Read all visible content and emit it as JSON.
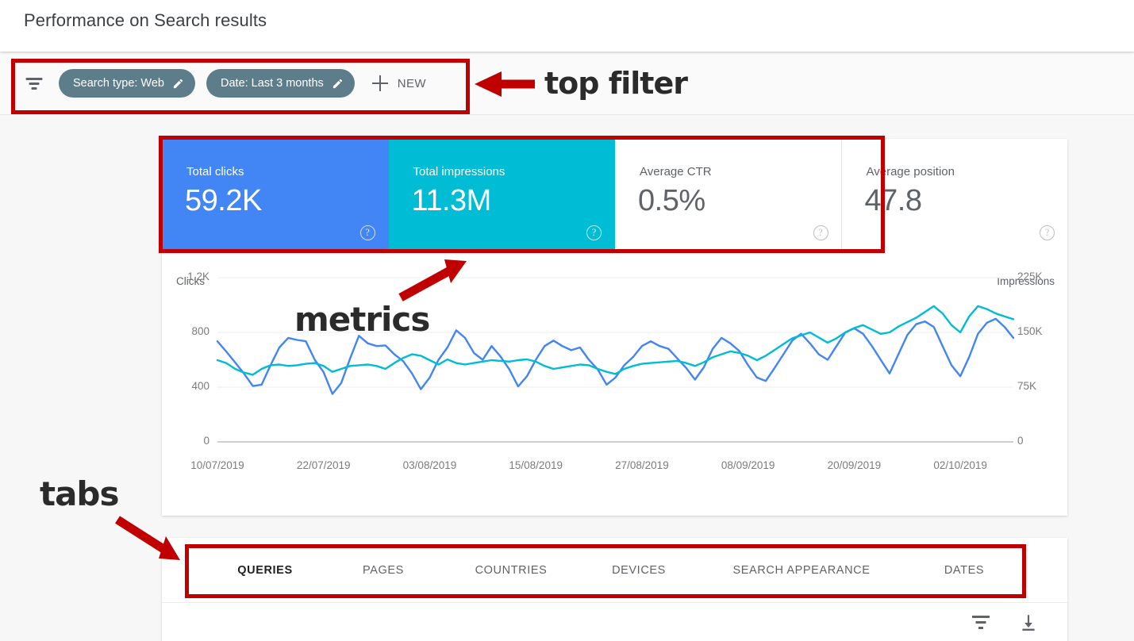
{
  "header": {
    "title": "Performance on Search results"
  },
  "filter_bar": {
    "funnel_icon": "filter-funnel-icon",
    "chips": [
      {
        "label": "Search type: Web",
        "edit_icon": "pencil-icon"
      },
      {
        "label": "Date: Last 3 months",
        "edit_icon": "pencil-icon"
      }
    ],
    "new_button": {
      "label": "NEW",
      "icon": "plus-icon"
    }
  },
  "metrics": [
    {
      "label": "Total clicks",
      "value": "59.2K",
      "selected": true,
      "color": "#4285f4",
      "help_icon": "help-circle-icon"
    },
    {
      "label": "Total impressions",
      "value": "11.3M",
      "selected": true,
      "color": "#00bcd4",
      "help_icon": "help-circle-icon"
    },
    {
      "label": "Average CTR",
      "value": "0.5%",
      "selected": false,
      "color": "#5f6368",
      "help_icon": "help-circle-icon"
    },
    {
      "label": "Average position",
      "value": "47.8",
      "selected": false,
      "color": "#5f6368",
      "help_icon": "help-circle-icon"
    }
  ],
  "tabs": [
    {
      "label": "QUERIES",
      "active": true
    },
    {
      "label": "PAGES",
      "active": false
    },
    {
      "label": "COUNTRIES",
      "active": false
    },
    {
      "label": "DEVICES",
      "active": false
    },
    {
      "label": "SEARCH APPEARANCE",
      "active": false
    },
    {
      "label": "DATES",
      "active": false
    }
  ],
  "table_toolbar": {
    "filter_icon": "filter-funnel-icon",
    "download_icon": "download-icon"
  },
  "annotations": [
    {
      "text": "top filter",
      "target": "filter-bar",
      "arrow": "left"
    },
    {
      "text": "metrics",
      "target": "metrics-row",
      "arrow": "up-right"
    },
    {
      "text": "tabs",
      "target": "tabs-row",
      "arrow": "down-right"
    }
  ],
  "chart_data": {
    "type": "line",
    "title": "",
    "xlabel": "",
    "ylabel": "Clicks",
    "y2label": "Impressions",
    "ylim": [
      0,
      1200
    ],
    "y2lim": [
      0,
      225000
    ],
    "yticks": [
      "0",
      "400",
      "800",
      "1.2K"
    ],
    "ytick_values": [
      0,
      400,
      800,
      1200
    ],
    "y2ticks": [
      "0",
      "75K",
      "150K",
      "225K"
    ],
    "y2tick_values": [
      0,
      75000,
      150000,
      225000
    ],
    "grid": true,
    "legend": "none",
    "xticks": [
      "10/07/2019",
      "22/07/2019",
      "03/08/2019",
      "15/08/2019",
      "27/08/2019",
      "08/09/2019",
      "20/09/2019",
      "02/10/2019"
    ],
    "xtick_indices": [
      0,
      12,
      24,
      36,
      48,
      60,
      72,
      84
    ],
    "series": [
      {
        "name": "Clicks",
        "color": "#4285f4",
        "axis": "left",
        "values": [
          735,
          660,
          580,
          500,
          408,
          418,
          560,
          690,
          760,
          745,
          735,
          600,
          510,
          350,
          430,
          610,
          775,
          720,
          700,
          705,
          640,
          590,
          500,
          385,
          470,
          600,
          690,
          815,
          760,
          650,
          600,
          700,
          625,
          530,
          405,
          480,
          600,
          700,
          740,
          700,
          670,
          690,
          600,
          530,
          418,
          470,
          560,
          620,
          700,
          735,
          700,
          680,
          610,
          540,
          455,
          545,
          680,
          760,
          720,
          665,
          560,
          470,
          445,
          540,
          640,
          740,
          790,
          720,
          640,
          600,
          700,
          800,
          830,
          790,
          700,
          600,
          500,
          640,
          780,
          860,
          880,
          840,
          700,
          560,
          480,
          620,
          790,
          870,
          900,
          840,
          760
        ]
      },
      {
        "name": "Impressions",
        "color": "#00bcd4",
        "axis": "right",
        "values": [
          112000,
          108000,
          100000,
          95000,
          92000,
          100000,
          105000,
          106000,
          104000,
          105000,
          107000,
          108000,
          104000,
          96000,
          100000,
          104000,
          105000,
          106000,
          104000,
          100000,
          108000,
          115000,
          120000,
          118000,
          112000,
          106000,
          113000,
          108000,
          106000,
          108000,
          110000,
          112000,
          111000,
          110000,
          112000,
          113000,
          110000,
          104000,
          100000,
          102000,
          104000,
          106000,
          105000,
          100000,
          96000,
          93000,
          100000,
          104000,
          107000,
          108000,
          109000,
          110000,
          111000,
          108000,
          104000,
          109000,
          116000,
          120000,
          124000,
          122000,
          118000,
          112000,
          118000,
          126000,
          134000,
          142000,
          146000,
          150000,
          143000,
          136000,
          142000,
          150000,
          156000,
          160000,
          154000,
          148000,
          150000,
          158000,
          164000,
          170000,
          178000,
          186000,
          176000,
          160000,
          150000,
          172000,
          186000,
          182000,
          176000,
          172000,
          168000
        ]
      }
    ]
  }
}
